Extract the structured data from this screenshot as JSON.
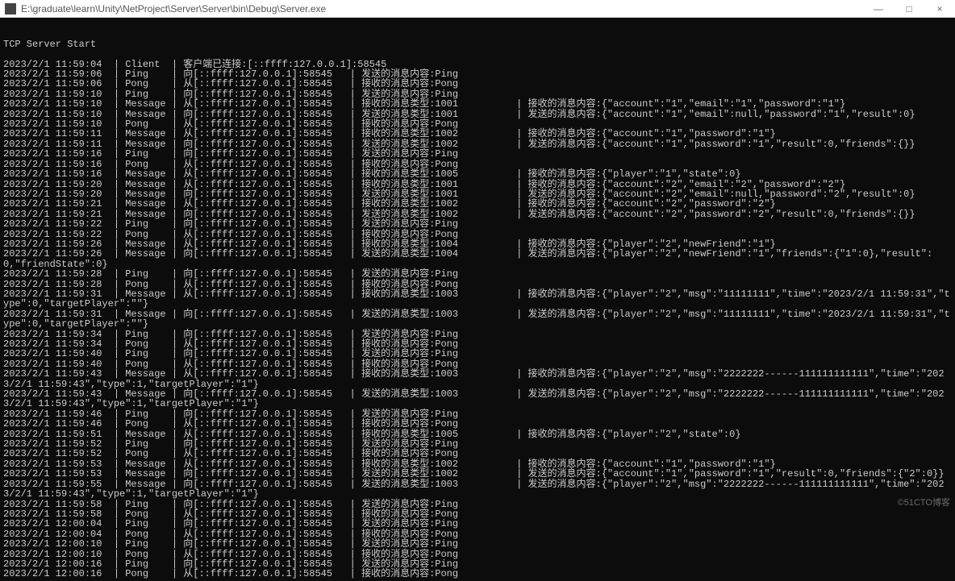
{
  "window": {
    "title": "E:\\graduate\\learn\\Unity\\NetProject\\Server\\Server\\bin\\Debug\\Server.exe",
    "min": "—",
    "max": "□",
    "close": "×"
  },
  "watermark": "©51CTO博客",
  "header": "TCP Server Start",
  "logs": [
    {
      "ts": "2023/2/1 11:59:04",
      "type": "Client",
      "dir": "",
      "addr": "",
      "msg": "客户端已连接:[::ffff:127.0.0.1]:58545",
      "extra": ""
    },
    {
      "ts": "2023/2/1 11:59:06",
      "type": "Ping",
      "dir": "向",
      "addr": "[::ffff:127.0.0.1]:58545",
      "msg": "发送的消息内容:Ping",
      "extra": ""
    },
    {
      "ts": "2023/2/1 11:59:06",
      "type": "Pong",
      "dir": "从",
      "addr": "[::ffff:127.0.0.1]:58545",
      "msg": "接收的消息内容:Pong",
      "extra": ""
    },
    {
      "ts": "2023/2/1 11:59:10",
      "type": "Ping",
      "dir": "向",
      "addr": "[::ffff:127.0.0.1]:58545",
      "msg": "发送的消息内容:Ping",
      "extra": ""
    },
    {
      "ts": "2023/2/1 11:59:10",
      "type": "Message",
      "dir": "从",
      "addr": "[::ffff:127.0.0.1]:58545",
      "msg": "接收的消息类型:1001",
      "extra": "接收的消息内容:{\"account\":\"1\",\"email\":\"1\",\"password\":\"1\"}"
    },
    {
      "ts": "2023/2/1 11:59:10",
      "type": "Message",
      "dir": "向",
      "addr": "[::ffff:127.0.0.1]:58545",
      "msg": "发送的消息类型:1001",
      "extra": "发送的消息内容:{\"account\":\"1\",\"email\":null,\"password\":\"1\",\"result\":0}"
    },
    {
      "ts": "2023/2/1 11:59:10",
      "type": "Pong",
      "dir": "从",
      "addr": "[::ffff:127.0.0.1]:58545",
      "msg": "接收的消息内容:Pong",
      "extra": ""
    },
    {
      "ts": "2023/2/1 11:59:11",
      "type": "Message",
      "dir": "从",
      "addr": "[::ffff:127.0.0.1]:58545",
      "msg": "接收的消息类型:1002",
      "extra": "接收的消息内容:{\"account\":\"1\",\"password\":\"1\"}"
    },
    {
      "ts": "2023/2/1 11:59:11",
      "type": "Message",
      "dir": "向",
      "addr": "[::ffff:127.0.0.1]:58545",
      "msg": "发送的消息类型:1002",
      "extra": "发送的消息内容:{\"account\":\"1\",\"password\":\"1\",\"result\":0,\"friends\":{}}"
    },
    {
      "ts": "2023/2/1 11:59:16",
      "type": "Ping",
      "dir": "向",
      "addr": "[::ffff:127.0.0.1]:58545",
      "msg": "发送的消息内容:Ping",
      "extra": ""
    },
    {
      "ts": "2023/2/1 11:59:16",
      "type": "Pong",
      "dir": "从",
      "addr": "[::ffff:127.0.0.1]:58545",
      "msg": "接收的消息内容:Pong",
      "extra": ""
    },
    {
      "ts": "2023/2/1 11:59:16",
      "type": "Message",
      "dir": "从",
      "addr": "[::ffff:127.0.0.1]:58545",
      "msg": "接收的消息类型:1005",
      "extra": "接收的消息内容:{\"player\":\"1\",\"state\":0}"
    },
    {
      "ts": "2023/2/1 11:59:20",
      "type": "Message",
      "dir": "从",
      "addr": "[::ffff:127.0.0.1]:58545",
      "msg": "接收的消息类型:1001",
      "extra": "接收的消息内容:{\"account\":\"2\",\"email\":\"2\",\"password\":\"2\"}"
    },
    {
      "ts": "2023/2/1 11:59:20",
      "type": "Message",
      "dir": "向",
      "addr": "[::ffff:127.0.0.1]:58545",
      "msg": "发送的消息类型:1001",
      "extra": "发送的消息内容:{\"account\":\"2\",\"email\":null,\"password\":\"2\",\"result\":0}"
    },
    {
      "ts": "2023/2/1 11:59:21",
      "type": "Message",
      "dir": "从",
      "addr": "[::ffff:127.0.0.1]:58545",
      "msg": "接收的消息类型:1002",
      "extra": "接收的消息内容:{\"account\":\"2\",\"password\":\"2\"}"
    },
    {
      "ts": "2023/2/1 11:59:21",
      "type": "Message",
      "dir": "向",
      "addr": "[::ffff:127.0.0.1]:58545",
      "msg": "发送的消息类型:1002",
      "extra": "发送的消息内容:{\"account\":\"2\",\"password\":\"2\",\"result\":0,\"friends\":{}}"
    },
    {
      "ts": "2023/2/1 11:59:22",
      "type": "Ping",
      "dir": "向",
      "addr": "[::ffff:127.0.0.1]:58545",
      "msg": "发送的消息内容:Ping",
      "extra": ""
    },
    {
      "ts": "2023/2/1 11:59:22",
      "type": "Pong",
      "dir": "从",
      "addr": "[::ffff:127.0.0.1]:58545",
      "msg": "接收的消息内容:Pong",
      "extra": ""
    },
    {
      "ts": "2023/2/1 11:59:26",
      "type": "Message",
      "dir": "从",
      "addr": "[::ffff:127.0.0.1]:58545",
      "msg": "接收的消息类型:1004",
      "extra": "接收的消息内容:{\"player\":\"2\",\"newFriend\":\"1\"}"
    },
    {
      "ts": "2023/2/1 11:59:26",
      "type": "Message",
      "dir": "向",
      "addr": "[::ffff:127.0.0.1]:58545",
      "msg": "发送的消息类型:1004",
      "extra": "发送的消息内容:{\"player\":\"2\",\"newFriend\":\"1\",\"friends\":{\"1\":0},\"result\":0,\"friendState\":0}"
    },
    {
      "ts": "2023/2/1 11:59:28",
      "type": "Ping",
      "dir": "向",
      "addr": "[::ffff:127.0.0.1]:58545",
      "msg": "发送的消息内容:Ping",
      "extra": ""
    },
    {
      "ts": "2023/2/1 11:59:28",
      "type": "Pong",
      "dir": "从",
      "addr": "[::ffff:127.0.0.1]:58545",
      "msg": "接收的消息内容:Pong",
      "extra": ""
    },
    {
      "ts": "2023/2/1 11:59:31",
      "type": "Message",
      "dir": "从",
      "addr": "[::ffff:127.0.0.1]:58545",
      "msg": "接收的消息类型:1003",
      "extra": "接收的消息内容:{\"player\":\"2\",\"msg\":\"11111111\",\"time\":\"2023/2/1 11:59:31\",\"type\":0,\"targetPlayer\":\"\"}"
    },
    {
      "ts": "2023/2/1 11:59:31",
      "type": "Message",
      "dir": "向",
      "addr": "[::ffff:127.0.0.1]:58545",
      "msg": "发送的消息类型:1003",
      "extra": "发送的消息内容:{\"player\":\"2\",\"msg\":\"11111111\",\"time\":\"2023/2/1 11:59:31\",\"type\":0,\"targetPlayer\":\"\"}"
    },
    {
      "ts": "2023/2/1 11:59:34",
      "type": "Ping",
      "dir": "向",
      "addr": "[::ffff:127.0.0.1]:58545",
      "msg": "发送的消息内容:Ping",
      "extra": ""
    },
    {
      "ts": "2023/2/1 11:59:34",
      "type": "Pong",
      "dir": "从",
      "addr": "[::ffff:127.0.0.1]:58545",
      "msg": "接收的消息内容:Pong",
      "extra": ""
    },
    {
      "ts": "2023/2/1 11:59:40",
      "type": "Ping",
      "dir": "向",
      "addr": "[::ffff:127.0.0.1]:58545",
      "msg": "发送的消息内容:Ping",
      "extra": ""
    },
    {
      "ts": "2023/2/1 11:59:40",
      "type": "Pong",
      "dir": "从",
      "addr": "[::ffff:127.0.0.1]:58545",
      "msg": "接收的消息内容:Pong",
      "extra": ""
    },
    {
      "ts": "2023/2/1 11:59:43",
      "type": "Message",
      "dir": "从",
      "addr": "[::ffff:127.0.0.1]:58545",
      "msg": "接收的消息类型:1003",
      "extra": "接收的消息内容:{\"player\":\"2\",\"msg\":\"2222222------111111111111\",\"time\":\"2023/2/1 11:59:43\",\"type\":1,\"targetPlayer\":\"1\"}"
    },
    {
      "ts": "",
      "type": "",
      "dir": "",
      "addr": "",
      "msg": "",
      "extra": ""
    },
    {
      "ts": "2023/2/1 11:59:43",
      "type": "Message",
      "dir": "向",
      "addr": "[::ffff:127.0.0.1]:58545",
      "msg": "发送的消息类型:1003",
      "extra": "发送的消息内容:{\"player\":\"2\",\"msg\":\"2222222------111111111111\",\"time\":\"2023/2/1 11:59:43\",\"type\":1,\"targetPlayer\":\"1\"}"
    },
    {
      "ts": "",
      "type": "",
      "dir": "",
      "addr": "",
      "msg": "",
      "extra": ""
    },
    {
      "ts": "2023/2/1 11:59:46",
      "type": "Ping",
      "dir": "向",
      "addr": "[::ffff:127.0.0.1]:58545",
      "msg": "发送的消息内容:Ping",
      "extra": ""
    },
    {
      "ts": "2023/2/1 11:59:46",
      "type": "Pong",
      "dir": "从",
      "addr": "[::ffff:127.0.0.1]:58545",
      "msg": "接收的消息内容:Pong",
      "extra": ""
    },
    {
      "ts": "2023/2/1 11:59:51",
      "type": "Message",
      "dir": "从",
      "addr": "[::ffff:127.0.0.1]:58545",
      "msg": "接收的消息类型:1005",
      "extra": "接收的消息内容:{\"player\":\"2\",\"state\":0}"
    },
    {
      "ts": "2023/2/1 11:59:52",
      "type": "Ping",
      "dir": "向",
      "addr": "[::ffff:127.0.0.1]:58545",
      "msg": "发送的消息内容:Ping",
      "extra": ""
    },
    {
      "ts": "2023/2/1 11:59:52",
      "type": "Pong",
      "dir": "从",
      "addr": "[::ffff:127.0.0.1]:58545",
      "msg": "接收的消息内容:Pong",
      "extra": ""
    },
    {
      "ts": "2023/2/1 11:59:53",
      "type": "Message",
      "dir": "从",
      "addr": "[::ffff:127.0.0.1]:58545",
      "msg": "接收的消息类型:1002",
      "extra": "接收的消息内容:{\"account\":\"1\",\"password\":\"1\"}"
    },
    {
      "ts": "2023/2/1 11:59:53",
      "type": "Message",
      "dir": "向",
      "addr": "[::ffff:127.0.0.1]:58545",
      "msg": "发送的消息类型:1002",
      "extra": "发送的消息内容:{\"account\":\"1\",\"password\":\"1\",\"result\":0,\"friends\":{\"2\":0}}"
    },
    {
      "ts": "2023/2/1 11:59:55",
      "type": "Message",
      "dir": "向",
      "addr": "[::ffff:127.0.0.1]:58545",
      "msg": "发送的消息类型:1003",
      "extra": "发送的消息内容:{\"player\":\"2\",\"msg\":\"2222222------111111111111\",\"time\":\"2023/2/1 11:59:43\",\"type\":1,\"targetPlayer\":\"1\"}"
    },
    {
      "ts": "",
      "type": "",
      "dir": "",
      "addr": "",
      "msg": "",
      "extra": ""
    },
    {
      "ts": "2023/2/1 11:59:58",
      "type": "Ping",
      "dir": "向",
      "addr": "[::ffff:127.0.0.1]:58545",
      "msg": "发送的消息内容:Ping",
      "extra": ""
    },
    {
      "ts": "2023/2/1 11:59:58",
      "type": "Pong",
      "dir": "从",
      "addr": "[::ffff:127.0.0.1]:58545",
      "msg": "接收的消息内容:Pong",
      "extra": ""
    },
    {
      "ts": "2023/2/1 12:00:04",
      "type": "Ping",
      "dir": "向",
      "addr": "[::ffff:127.0.0.1]:58545",
      "msg": "发送的消息内容:Ping",
      "extra": ""
    },
    {
      "ts": "2023/2/1 12:00:04",
      "type": "Pong",
      "dir": "从",
      "addr": "[::ffff:127.0.0.1]:58545",
      "msg": "接收的消息内容:Pong",
      "extra": ""
    },
    {
      "ts": "2023/2/1 12:00:10",
      "type": "Ping",
      "dir": "向",
      "addr": "[::ffff:127.0.0.1]:58545",
      "msg": "发送的消息内容:Ping",
      "extra": ""
    },
    {
      "ts": "2023/2/1 12:00:10",
      "type": "Pong",
      "dir": "从",
      "addr": "[::ffff:127.0.0.1]:58545",
      "msg": "接收的消息内容:Pong",
      "extra": ""
    },
    {
      "ts": "2023/2/1 12:00:16",
      "type": "Ping",
      "dir": "向",
      "addr": "[::ffff:127.0.0.1]:58545",
      "msg": "发送的消息内容:Ping",
      "extra": ""
    },
    {
      "ts": "2023/2/1 12:00:16",
      "type": "Pong",
      "dir": "从",
      "addr": "[::ffff:127.0.0.1]:58545",
      "msg": "接收的消息内容:Pong",
      "extra": ""
    }
  ]
}
